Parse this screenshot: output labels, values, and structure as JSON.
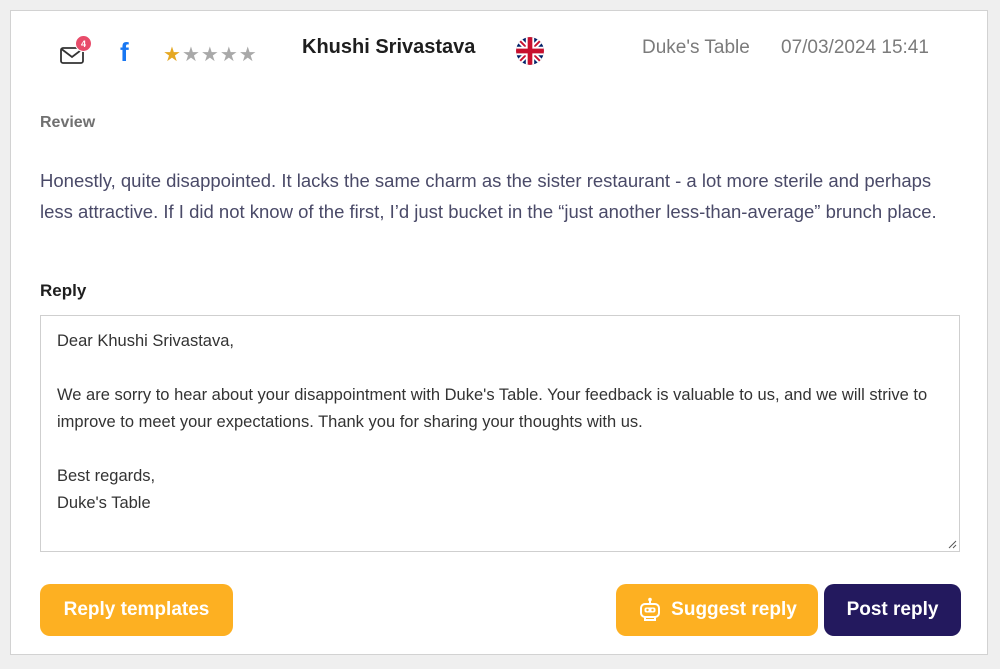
{
  "header": {
    "mail_badge_count": "4",
    "source_icon": "facebook-icon",
    "rating": 1,
    "rating_max": 5,
    "reviewer_name": "Khushi Srivastava",
    "flag_icon": "uk-flag-icon",
    "location": "Duke's Table",
    "datetime": "07/03/2024 15:41"
  },
  "review": {
    "label": "Review",
    "text": "Honestly, quite disappointed. It lacks the same charm as the sister restaurant - a lot more sterile and perhaps less attractive. If I did not know of the first, I’d just bucket in the “just another less-than-average” brunch place."
  },
  "reply": {
    "label": "Reply",
    "text": "Dear Khushi Srivastava,\n\nWe are sorry to hear about your disappointment with Duke's Table. Your feedback is valuable to us, and we will strive to improve to meet your expectations. Thank you for sharing your thoughts with us.\n\nBest regards,\nDuke's Table"
  },
  "actions": {
    "templates_label": "Reply templates",
    "suggest_label": "Suggest reply",
    "post_label": "Post reply"
  },
  "colors": {
    "accent_orange": "#fdb022",
    "primary_navy": "#23195e",
    "star_filled": "#e5a823",
    "star_empty": "#a9a9a9",
    "facebook_blue": "#1877f2",
    "badge_red": "#e84c6a"
  }
}
